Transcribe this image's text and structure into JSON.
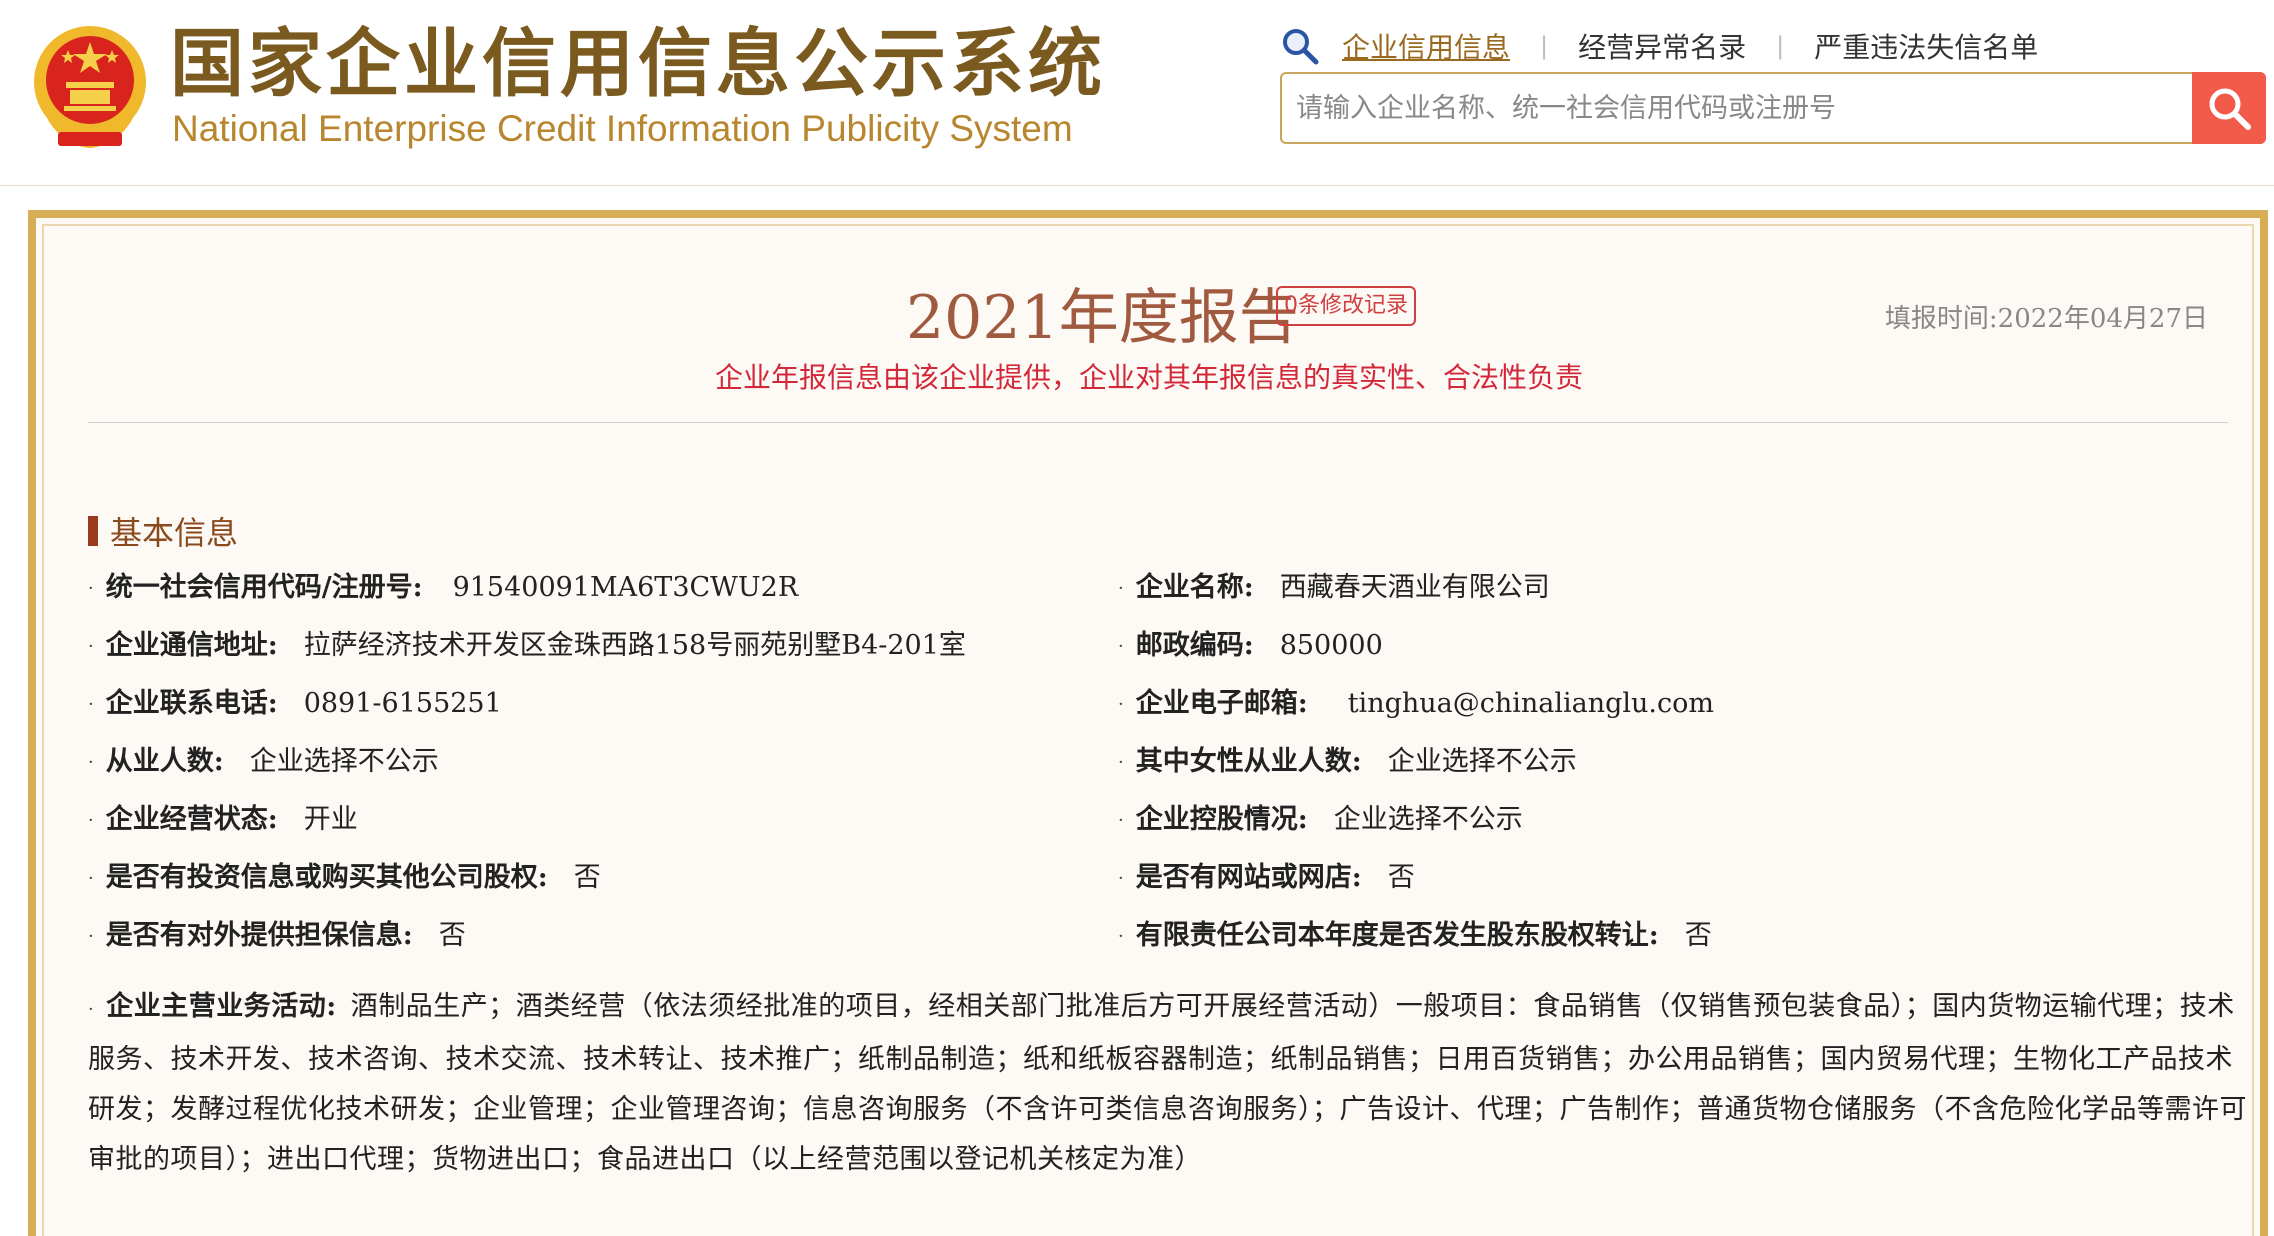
{
  "header": {
    "title": "国家企业信用信息公示系统",
    "subtitle": "National Enterprise Credit Information Publicity System",
    "links": [
      "企业信用信息",
      "经营异常名录",
      "严重违法失信名单"
    ],
    "search_placeholder": "请输入企业名称、统一社会信用代码或注册号",
    "icons": {
      "emblem": "national-emblem-icon",
      "search": "magnifier-icon",
      "submit": "search-icon"
    },
    "colors": {
      "brand": "#7a5a1e",
      "accent": "#c9a55d",
      "search_button": "#f25a4a"
    }
  },
  "report": {
    "title": "2021年度报告",
    "modify_badge": "0条修改记录",
    "fill_time": "填报时间:2022年04月27日",
    "disclaimer": "企业年报信息由该企业提供，企业对其年报信息的真实性、合法性负责",
    "section_title": "基本信息",
    "rows": [
      {
        "label": "统一社会信用代码/注册号:",
        "value": "91540091MA6T3CWU2R"
      },
      {
        "label": "企业名称:",
        "value": "西藏春天酒业有限公司"
      },
      {
        "label": "企业通信地址:",
        "value": "拉萨经济技术开发区金珠西路158号丽苑别墅B4-201室"
      },
      {
        "label": "邮政编码:",
        "value": "850000"
      },
      {
        "label": "企业联系电话:",
        "value": "0891-6155251"
      },
      {
        "label": "企业电子邮箱:",
        "value": "tinghua@chinalianglu.com"
      },
      {
        "label": "从业人数:",
        "value": "企业选择不公示"
      },
      {
        "label": "其中女性从业人数:",
        "value": "企业选择不公示"
      },
      {
        "label": "企业经营状态:",
        "value": "开业"
      },
      {
        "label": "企业控股情况:",
        "value": "企业选择不公示"
      },
      {
        "label": "是否有投资信息或购买其他公司股权:",
        "value": "否"
      },
      {
        "label": "是否有网站或网店:",
        "value": "否"
      },
      {
        "label": "是否有对外提供担保信息:",
        "value": "否"
      },
      {
        "label": "有限责任公司本年度是否发生股东股权转让:",
        "value": "否"
      }
    ],
    "activity": {
      "label": "企业主营业务活动:",
      "value": "酒制品生产；酒类经营（依法须经批准的项目，经相关部门批准后方可开展经营活动）一般项目：食品销售（仅销售预包装食品）；国内货物运输代理；技术服务、技术开发、技术咨询、技术交流、技术转让、技术推广；纸制品制造；纸和纸板容器制造；纸制品销售；日用百货销售；办公用品销售；国内贸易代理；生物化工产品技术研发；发酵过程优化技术研发；企业管理；企业管理咨询；信息咨询服务（不含许可类信息咨询服务）；广告设计、代理；广告制作；普通货物仓储服务（不含危险化学品等需许可审批的项目）；进出口代理；货物进出口；食品进出口（以上经营范围以登记机关核定为准）"
    }
  }
}
